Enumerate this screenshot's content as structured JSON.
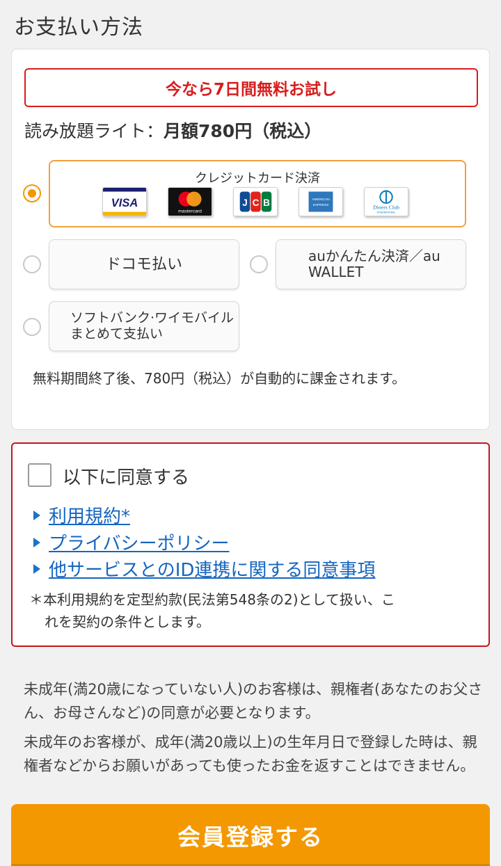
{
  "section_title": "お支払い方法",
  "trial_banner": "今なら7日間無料お試し",
  "plan": {
    "name": "読み放題ライト：",
    "price": "月額780円（税込）"
  },
  "payment_options": {
    "credit_card": {
      "label": "クレジットカード決済",
      "brands": [
        "VISA",
        "mastercard",
        "JCB",
        "AMERICAN EXPRESS",
        "Diners Club"
      ]
    },
    "docomo": "ドコモ払い",
    "au": "auかんたん決済／au WALLET",
    "softbank_line1": "ソフトバンク·ワイモバイル",
    "softbank_line2": "まとめて支払い",
    "selected": "credit_card"
  },
  "auto_charge_note": "無料期間終了後、780円（税込）が自動的に課金されます。",
  "agreement": {
    "checkbox_label": "以下に同意する",
    "checked": false,
    "links": [
      "利用規約*",
      "プライバシーポリシー",
      "他サービスとのID連携に関する同意事項"
    ],
    "note_line1": "＊本利用規約を定型約款(民法第548条の2)として扱い、こ",
    "note_line2": "れを契約の条件とします。"
  },
  "minor_notice_1": "未成年(満20歳になっていない人)のお客様は、親権者(あなたのお父さん、お母さんなど)の同意が必要となります。",
  "minor_notice_2": "未成年のお客様が、成年(満20歳以上)の生年月日で登録した時は、親権者などからお願いがあっても使ったお金を返すことはできません。",
  "register_button": "会員登録する",
  "colors": {
    "accent": "#f39800",
    "alert": "#d81c1c",
    "link": "#1565c0"
  }
}
